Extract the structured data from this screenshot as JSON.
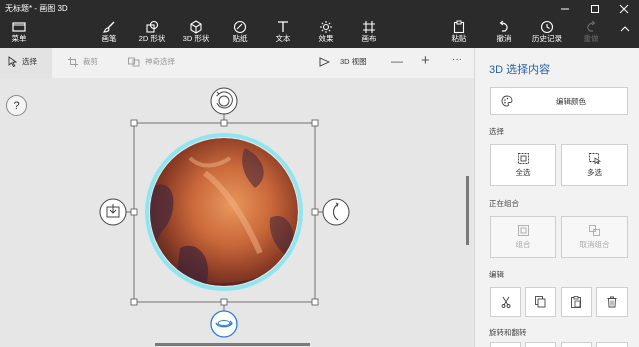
{
  "window": {
    "title": "无标题* - 画图 3D"
  },
  "ribbon": {
    "menu": "菜单",
    "brushes": "画笔",
    "shapes2d": "2D 形状",
    "shapes3d": "3D 形状",
    "stickers": "贴纸",
    "text": "文本",
    "effects": "效果",
    "canvas": "画布",
    "paste": "粘贴",
    "undo": "撤消",
    "history": "历史记录",
    "redo": "重做"
  },
  "toolbar": {
    "select": "选择",
    "crop": "裁剪",
    "magic_select": "神奇选择",
    "view3d": "3D 视图",
    "zoom_out": "—",
    "zoom_in": "+",
    "more": "···"
  },
  "canvas": {
    "help": "?"
  },
  "panel": {
    "title": "3D 选择内容",
    "edit_color": "编辑颜色",
    "section_select": "选择",
    "select_all": "全选",
    "multi_select": "多选",
    "section_group": "正在组合",
    "group": "组合",
    "ungroup": "取消组合",
    "section_edit": "编辑",
    "section_rotate": "旋转和翻转"
  },
  "colors": {
    "accent": "#2a5fa4",
    "selection_handle": "#ffffff",
    "planet_glow": "#8fe6f0"
  }
}
